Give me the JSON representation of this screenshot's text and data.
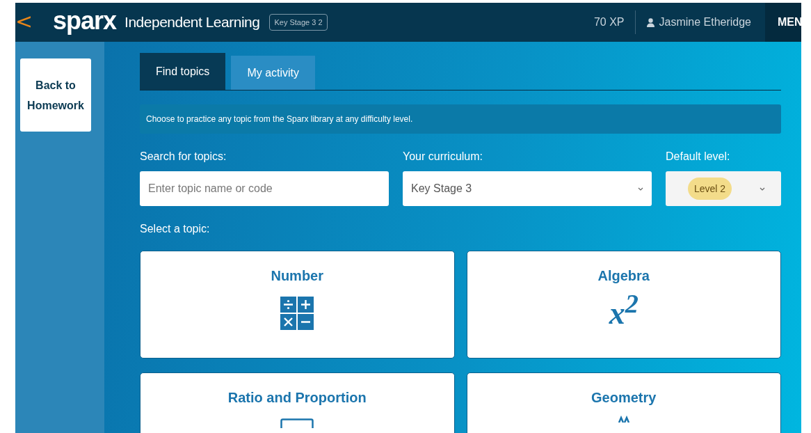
{
  "header": {
    "back": "<",
    "logo": "sparx",
    "title": "Independent Learning",
    "badge": "Key Stage 3 2",
    "xp": "70 XP",
    "user": "Jasmine Etheridge",
    "menu": "MEN"
  },
  "sidebar": {
    "back_button": "Back to Homework"
  },
  "tabs": [
    {
      "label": "Find topics",
      "selected": true
    },
    {
      "label": "My activity",
      "selected": false
    }
  ],
  "info": "Choose to practice any topic from the Sparx library at any difficulty level.",
  "search": {
    "label": "Search for topics:",
    "placeholder": "Enter topic name or code"
  },
  "curriculum": {
    "label": "Your curriculum:",
    "value": "Key Stage 3"
  },
  "level": {
    "label": "Default level:",
    "value": "Level 2"
  },
  "select_label": "Select a topic:",
  "topics": [
    {
      "name": "Number",
      "kind": "number"
    },
    {
      "name": "Algebra",
      "kind": "algebra",
      "icon_text": "x$^{2}$"
    },
    {
      "name": "Ratio and Proportion",
      "kind": "ratio"
    },
    {
      "name": "Geometry",
      "kind": "geometry"
    }
  ]
}
